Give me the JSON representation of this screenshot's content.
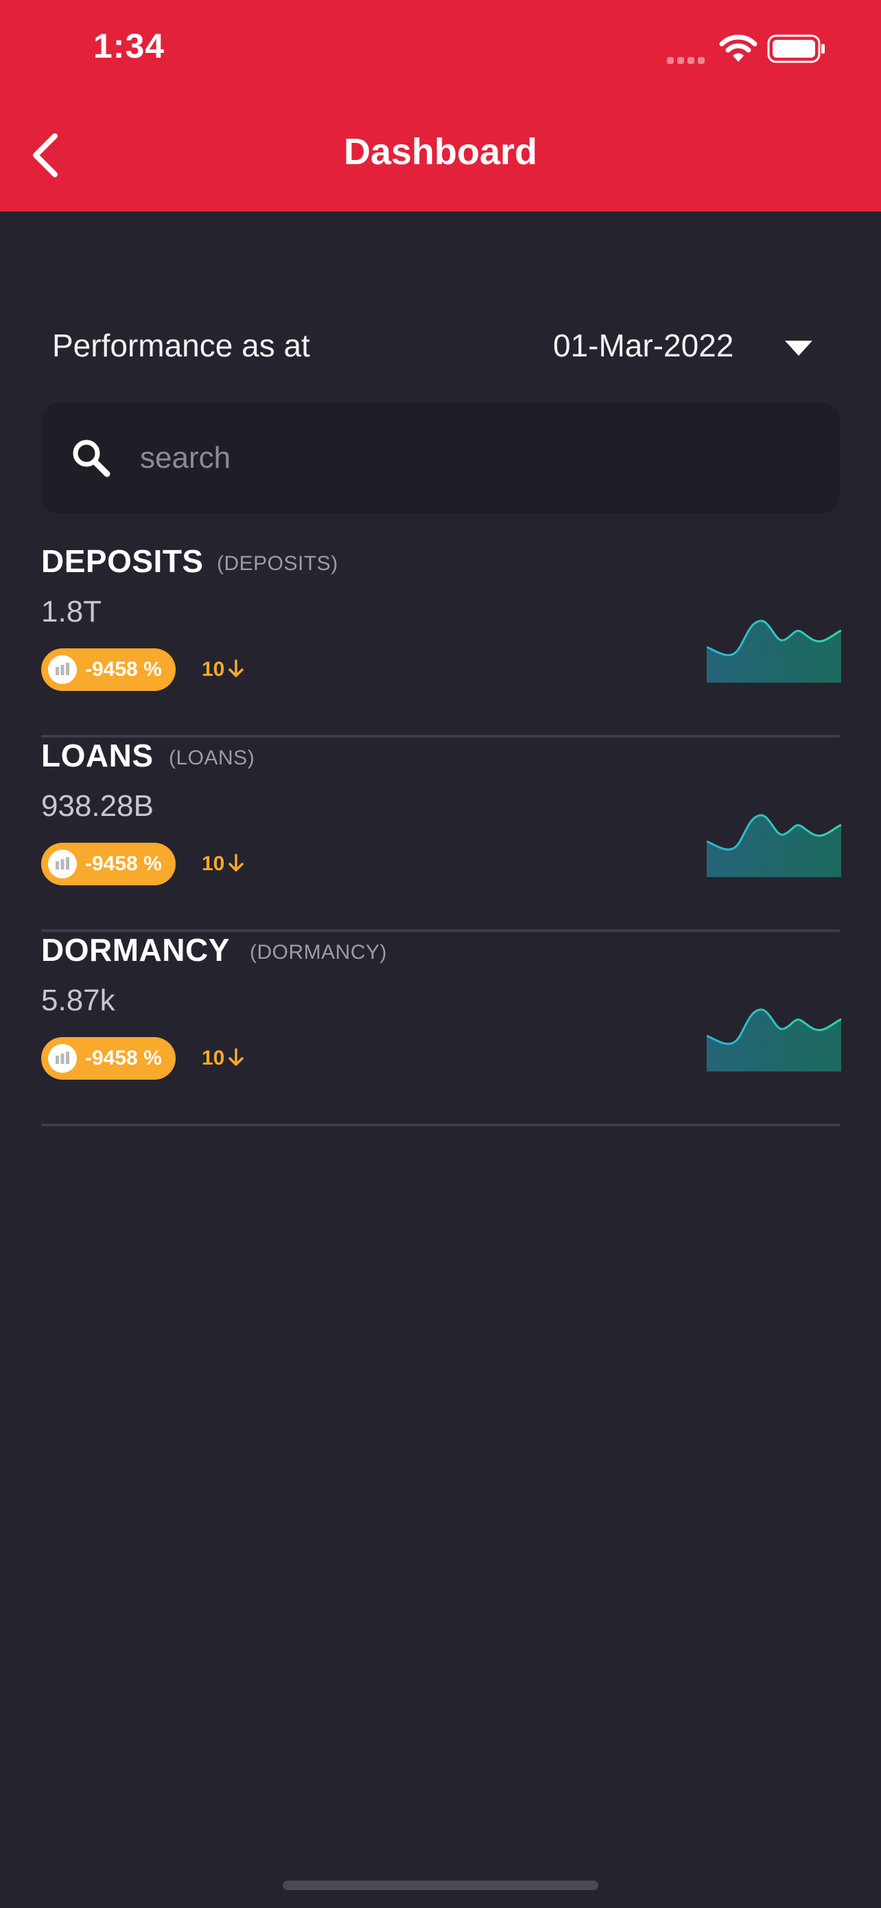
{
  "status_bar": {
    "time": "1:34"
  },
  "header": {
    "title": "Dashboard"
  },
  "performance": {
    "label": "Performance as at",
    "date": "01-Mar-2022"
  },
  "search": {
    "placeholder": "search"
  },
  "metrics": [
    {
      "title": "DEPOSITS",
      "subtitle": "(DEPOSITS)",
      "value": "1.8T",
      "change": "-9458 %",
      "rank": "10"
    },
    {
      "title": "LOANS",
      "subtitle": "(LOANS)",
      "value": "938.28B",
      "change": "-9458 %",
      "rank": "10"
    },
    {
      "title": "DORMANCY",
      "subtitle": "(DORMANCY)",
      "value": "5.87k",
      "change": "-9458 %",
      "rank": "10"
    }
  ],
  "colors": {
    "header": "#e4213a",
    "background": "#25242e",
    "accent": "#f9a92b",
    "sparkline_line": "#2ec4c4"
  }
}
